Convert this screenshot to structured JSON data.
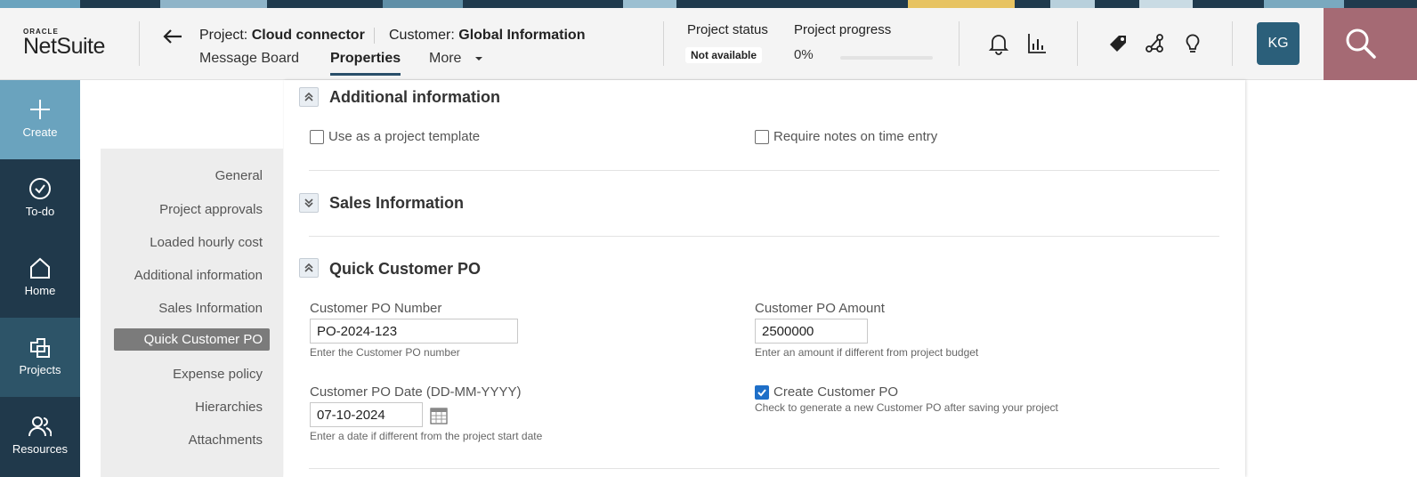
{
  "header": {
    "logo_oracle": "ORACLE",
    "logo_netsuite": "NetSuite",
    "project_prefix": "Project: ",
    "project_name": "Cloud connector",
    "customer_prefix": "Customer: ",
    "customer_name": "Global Information",
    "tabs": [
      "Message Board",
      "Properties",
      "More"
    ],
    "project_status_label": "Project status",
    "project_status_value": "Not available",
    "project_progress_label": "Project progress",
    "project_progress_value": "0%",
    "project_progress_fraction": 0,
    "avatar_initials": "KG"
  },
  "leftnav": {
    "items": [
      {
        "label": "Create",
        "icon": "plus-icon"
      },
      {
        "label": "To-do",
        "icon": "check-circle-icon"
      },
      {
        "label": "Home",
        "icon": "home-icon"
      },
      {
        "label": "Projects",
        "icon": "projects-icon"
      },
      {
        "label": "Resources",
        "icon": "people-icon"
      }
    ]
  },
  "secnav": {
    "items": [
      "General",
      "Project approvals",
      "Loaded hourly cost",
      "Additional information",
      "Sales Information",
      "Quick Customer PO",
      "Expense policy",
      "Hierarchies",
      "Attachments"
    ],
    "active": "Quick Customer PO"
  },
  "main": {
    "additional_info": {
      "title": "Additional information",
      "use_template_label": "Use as a project template",
      "use_template_checked": false,
      "require_notes_label": "Require notes on time entry",
      "require_notes_checked": false
    },
    "sales_info": {
      "title": "Sales Information"
    },
    "quick_po": {
      "title": "Quick Customer PO",
      "po_number_label": "Customer PO Number",
      "po_number_value": "PO-2024-123",
      "po_number_help": "Enter the Customer PO number",
      "po_amount_label": "Customer PO Amount",
      "po_amount_value": "2500000",
      "po_amount_help": "Enter an amount if different from project budget",
      "po_date_label": "Customer PO Date (DD-MM-YYYY)",
      "po_date_value": "07-10-2024",
      "po_date_help": "Enter a date if different from the project start date",
      "create_po_label": "Create Customer PO",
      "create_po_checked": true,
      "create_po_help": "Check to generate a new Customer PO after saving your project"
    }
  },
  "colors": {
    "nav_bg": "#20394b",
    "create_bg": "#6aa3be",
    "projects_bg": "#2d5468",
    "search_bg": "#a56a74",
    "avatar_bg": "#2b5f7a",
    "checkbox_checked": "#1e6fc8"
  }
}
